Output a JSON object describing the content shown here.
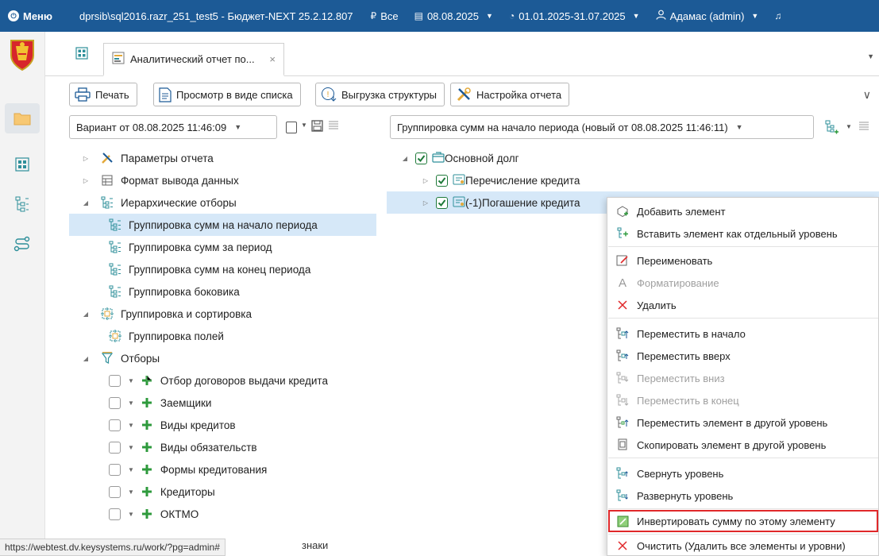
{
  "topbar": {
    "menu_label": "Меню",
    "app_title": "dprsib\\sql2016.razr_251_test5 - Бюджет-NEXT 25.2.12.807",
    "filter_label": "Все",
    "date_label": "08.08.2025",
    "period_label": "01.01.2025-31.07.2025",
    "user_label": "Адамас (admin)"
  },
  "tab": {
    "title": "Аналитический отчет по...",
    "close": "×"
  },
  "toolbar": {
    "print": "Печать",
    "list_view": "Просмотр в виде списка",
    "export_structure": "Выгрузка структуры",
    "report_settings": "Настройка отчета"
  },
  "left_panel": {
    "variant_select": "Вариант от 08.08.2025 11:46:09",
    "tree": [
      {
        "label": "Параметры отчета"
      },
      {
        "label": "Формат вывода данных"
      },
      {
        "label": "Иерархические отборы"
      },
      {
        "label": "Группировка сумм на начало периода"
      },
      {
        "label": "Группировка сумм за период"
      },
      {
        "label": "Группировка сумм на конец периода"
      },
      {
        "label": "Группировка боковика"
      },
      {
        "label": "Группировка и сортировка"
      },
      {
        "label": "Группировка полей"
      },
      {
        "label": "Отборы"
      },
      {
        "label": "Отбор договоров выдачи кредита"
      },
      {
        "label": "Заемщики"
      },
      {
        "label": "Виды кредитов"
      },
      {
        "label": "Виды обязательств"
      },
      {
        "label": "Формы кредитования"
      },
      {
        "label": "Кредиторы"
      },
      {
        "label": "ОКТМО"
      }
    ],
    "partial_text": "знаки"
  },
  "right_panel": {
    "group_select": "Группировка сумм на начало периода (новый от 08.08.2025 11:46:11)",
    "tree": [
      {
        "label": "Основной долг"
      },
      {
        "label": "Перечисление кредита"
      },
      {
        "label": "(-1)Погашение кредита"
      }
    ]
  },
  "context_menu": [
    {
      "label": "Добавить элемент",
      "icon": "add-element-icon",
      "disabled": false
    },
    {
      "label": "Вставить элемент как отдельный уровень",
      "icon": "insert-level-icon",
      "disabled": false
    },
    {
      "label": "Переименовать",
      "icon": "rename-icon",
      "disabled": false
    },
    {
      "label": "Форматирование",
      "icon": "format-icon",
      "disabled": true
    },
    {
      "label": "Удалить",
      "icon": "delete-icon",
      "disabled": false
    },
    {
      "label": "Переместить в начало",
      "icon": "move-top-icon",
      "disabled": false
    },
    {
      "label": "Переместить вверх",
      "icon": "move-up-icon",
      "disabled": false
    },
    {
      "label": "Переместить вниз",
      "icon": "move-down-icon",
      "disabled": true
    },
    {
      "label": "Переместить в конец",
      "icon": "move-bottom-icon",
      "disabled": true
    },
    {
      "label": "Переместить элемент в другой уровень",
      "icon": "move-level-icon",
      "disabled": false
    },
    {
      "label": "Скопировать элемент в другой уровень",
      "icon": "copy-level-icon",
      "disabled": false
    },
    {
      "label": "Свернуть уровень",
      "icon": "collapse-level-icon",
      "disabled": false
    },
    {
      "label": "Развернуть уровень",
      "icon": "expand-level-icon",
      "disabled": false
    },
    {
      "label": "Инвертировать сумму по этому элементу",
      "icon": "invert-sum-icon",
      "disabled": false,
      "highlighted": true
    },
    {
      "label": "Очистить (Удалить все элементы и уровни)",
      "icon": "clear-all-icon",
      "disabled": false
    }
  ],
  "status_url": "https://webtest.dv.keysystems.ru/work/?pg=admin#",
  "colors": {
    "topbar": "#1c5a96",
    "selection": "#d6e8f8",
    "highlight_border": "#e0282a",
    "green_icon": "#2e9a3c"
  }
}
